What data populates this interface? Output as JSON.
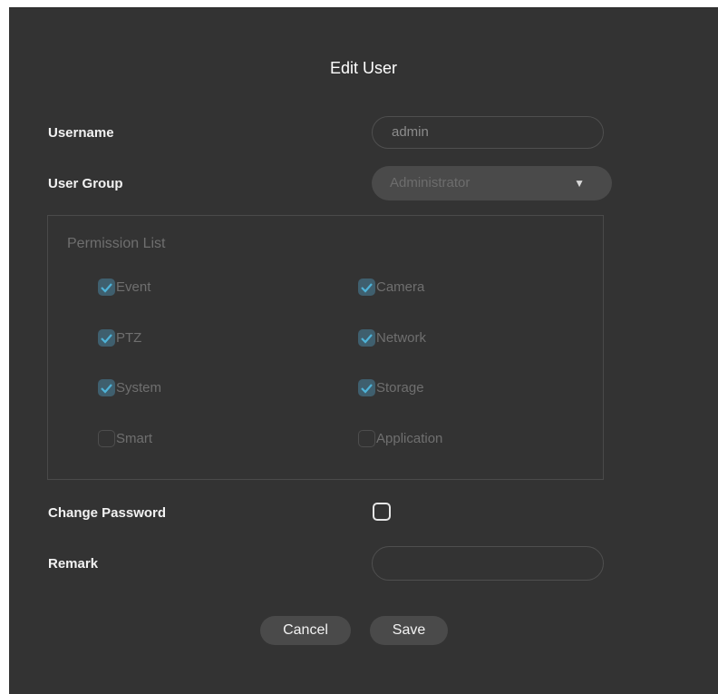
{
  "dialog": {
    "title": "Edit User"
  },
  "form": {
    "username": {
      "label": "Username",
      "value": "admin"
    },
    "user_group": {
      "label": "User Group",
      "value": "Administrator",
      "caret": "▼"
    },
    "change_password": {
      "label": "Change Password",
      "checked": false
    },
    "remark": {
      "label": "Remark",
      "value": ""
    }
  },
  "permissions": {
    "title": "Permission List",
    "items": [
      {
        "label": "Event",
        "checked": true
      },
      {
        "label": "Camera",
        "checked": true
      },
      {
        "label": "PTZ",
        "checked": true
      },
      {
        "label": "Network",
        "checked": true
      },
      {
        "label": "System",
        "checked": true
      },
      {
        "label": "Storage",
        "checked": true
      },
      {
        "label": "Smart",
        "checked": false
      },
      {
        "label": "Application",
        "checked": false
      }
    ]
  },
  "buttons": {
    "cancel": "Cancel",
    "save": "Save"
  },
  "colors": {
    "background": "#333333",
    "check_fill": "#3f5f6e",
    "check_mark": "#4fb3d8"
  }
}
